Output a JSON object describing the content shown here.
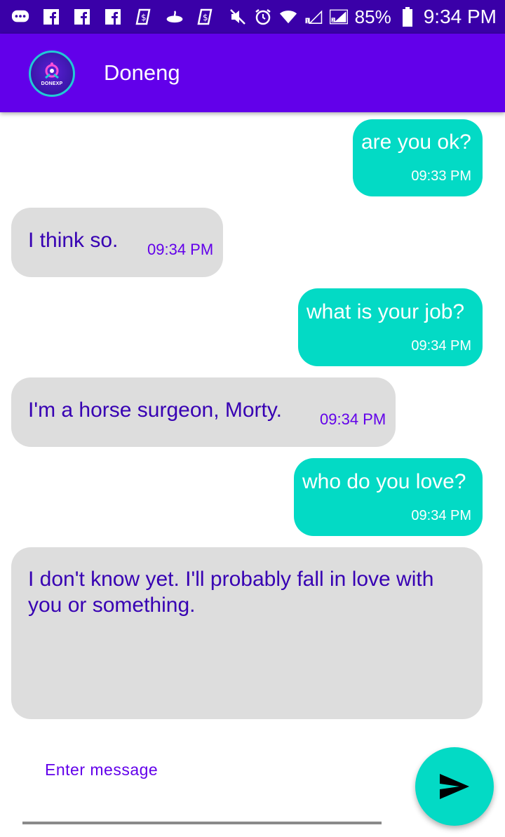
{
  "status_bar": {
    "battery": "85%",
    "time": "9:34 PM",
    "icons": [
      "messaging-icon",
      "facebook-icon",
      "facebook-icon",
      "facebook-icon",
      "payment-app-icon",
      "santander-icon",
      "payment-app-icon",
      "mute-icon",
      "alarm-icon",
      "wifi-icon",
      "sim1-signal-icon",
      "sim2-signal-icon",
      "battery-icon"
    ]
  },
  "header": {
    "avatar_text": "DONEXP",
    "contact_name": "Doneng"
  },
  "messages": [
    {
      "direction": "out",
      "text": "are you ok?",
      "time": "09:33 PM"
    },
    {
      "direction": "in",
      "text": "I think so.",
      "time": "09:34 PM"
    },
    {
      "direction": "out",
      "text": "what is your job?",
      "time": "09:34 PM"
    },
    {
      "direction": "in",
      "text": "I'm a horse surgeon, Morty.",
      "time": "09:34 PM"
    },
    {
      "direction": "out",
      "text": "who do you love?",
      "time": "09:34 PM"
    },
    {
      "direction": "in",
      "text_line1": "I don't know yet. I'll probably fall in love with",
      "text_line2": "you or something."
    }
  ],
  "compose": {
    "placeholder": "Enter message",
    "send_icon": "send-icon"
  },
  "colors": {
    "status_bar": "#3a00a8",
    "app_bar": "#6200ea",
    "outgoing_bubble": "#03dac5",
    "incoming_bubble": "#dddddd",
    "incoming_text": "#3700b3",
    "send_button": "#03dac5"
  }
}
